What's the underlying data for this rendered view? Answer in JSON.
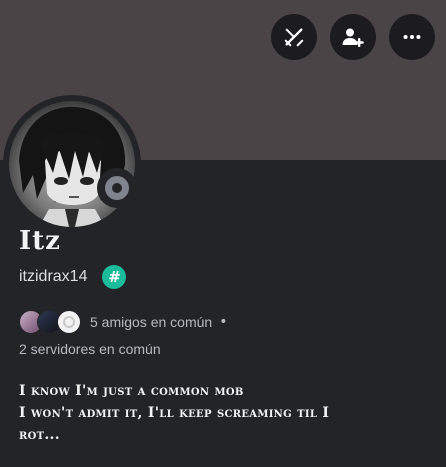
{
  "profile": {
    "display_name": "Itz",
    "username": "itzidrax14",
    "badge": "#",
    "status": "offline",
    "mutual_friends": "5 amigos en común",
    "mutual_servers": "2 servidores en común",
    "bio_lines": [
      "I know I'm just a common mob",
      "I won't admit it, I'll keep screaming til I",
      "rot..."
    ]
  },
  "icons": {
    "action_1": "swords-off-icon",
    "action_2": "add-friend-icon",
    "action_3": "more-options-icon"
  },
  "colors": {
    "banner": "#4a4446",
    "background": "#232428",
    "badge": "#1abc9c",
    "status_offline": "#80848e"
  }
}
